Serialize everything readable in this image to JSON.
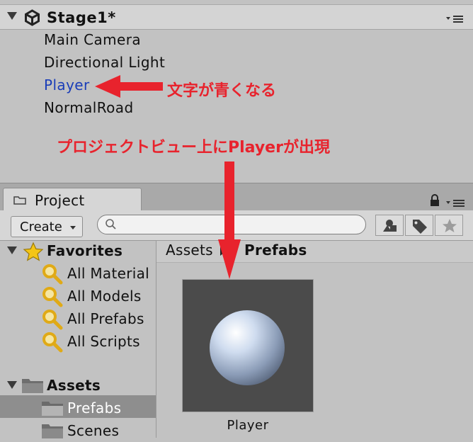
{
  "hierarchy": {
    "scene_name": "Stage1*",
    "items": [
      {
        "label": "Main Camera"
      },
      {
        "label": "Directional Light"
      },
      {
        "label": "Player"
      },
      {
        "label": "NormalRoad"
      }
    ]
  },
  "annotations": {
    "blue_text_note": "文字が青くなる",
    "appear_note": "プロジェクトビュー上にPlayerが出現",
    "color": "#e8232d"
  },
  "project": {
    "tab_label": "Project",
    "create_label": "Create",
    "search_placeholder": "",
    "favorites": {
      "label": "Favorites",
      "items": [
        "All Material",
        "All Models",
        "All Prefabs",
        "All Scripts"
      ]
    },
    "assets": {
      "label": "Assets",
      "items": [
        "Prefabs",
        "Scenes"
      ]
    },
    "breadcrumb": [
      "Assets",
      "Prefabs"
    ],
    "grid_items": [
      {
        "label": "Player"
      }
    ]
  },
  "colors": {
    "prefab_text": "#1a3db8",
    "panel_bg": "#c2c2c2",
    "selection": "#8e8e8e"
  }
}
